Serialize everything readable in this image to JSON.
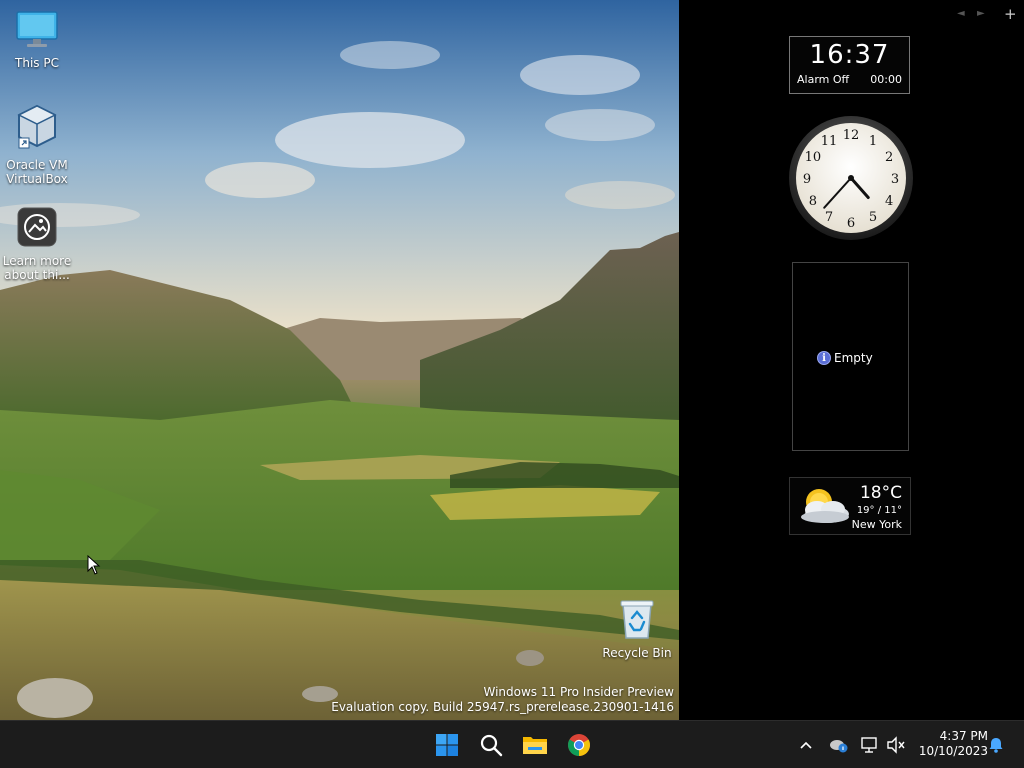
{
  "desktop": {
    "icons": [
      {
        "name": "This PC",
        "icon": "monitor-icon"
      },
      {
        "name": "Oracle VM VirtualBox",
        "icon": "virtualbox-icon"
      },
      {
        "name": "Learn more about thi...",
        "icon": "camera-icon"
      },
      {
        "name": "Recycle Bin",
        "icon": "recycle-bin-icon"
      }
    ],
    "watermark": {
      "line1": "Windows 11 Pro Insider Preview",
      "line2": "Evaluation copy. Build 25947.rs_prerelease.230901-1416"
    }
  },
  "sidebar": {
    "controls": {
      "prev": "◄",
      "next": "►",
      "add": "+"
    },
    "digital_clock": {
      "time": "16:37",
      "alarm_label": "Alarm Off",
      "alarm_time": "00:00"
    },
    "analog_clock": {
      "hour": 4,
      "minute": 37,
      "numerals": [
        "12",
        "1",
        "2",
        "3",
        "4",
        "5",
        "6",
        "7",
        "8",
        "9",
        "10",
        "11"
      ]
    },
    "empty_gadget": {
      "label": "Empty",
      "icon": "info-icon"
    },
    "weather": {
      "temp": "18°C",
      "range": "19° / 11°",
      "city": "New York",
      "icon": "partly-cloudy-icon"
    }
  },
  "taskbar": {
    "apps": [
      {
        "name": "Start",
        "icon": "windows-logo-icon"
      },
      {
        "name": "Search",
        "icon": "search-icon"
      },
      {
        "name": "File Explorer",
        "icon": "folder-icon"
      },
      {
        "name": "Google Chrome",
        "icon": "chrome-icon"
      }
    ],
    "tray": {
      "time": "4:37 PM",
      "date": "10/10/2023"
    }
  },
  "colors": {
    "taskbar": "#1c1c1c",
    "sidebar": "#000000",
    "accent": "#0078d4"
  }
}
